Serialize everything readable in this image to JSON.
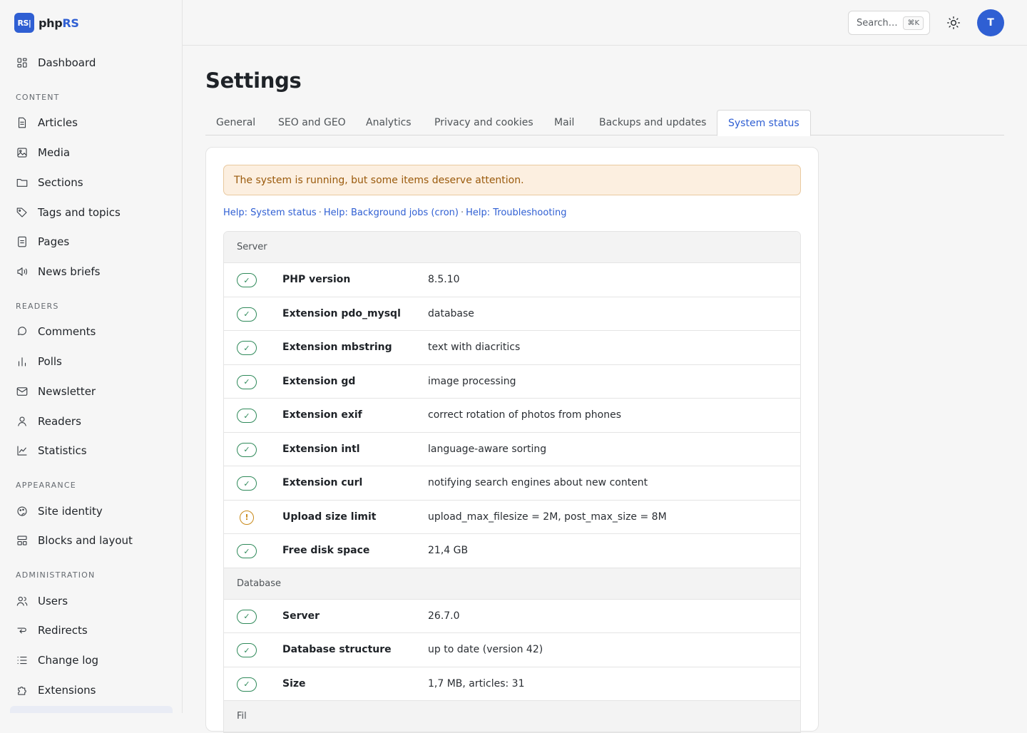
{
  "app": {
    "logo_mark": "RS|",
    "name_prefix": "php",
    "name_suffix": "RS"
  },
  "sidebar": {
    "dashboard": "Dashboard",
    "sections": [
      {
        "title": "CONTENT",
        "items": [
          "Articles",
          "Media",
          "Sections",
          "Tags and topics",
          "Pages",
          "News briefs"
        ]
      },
      {
        "title": "READERS",
        "items": [
          "Comments",
          "Polls",
          "Newsletter",
          "Readers",
          "Statistics"
        ]
      },
      {
        "title": "APPEARANCE",
        "items": [
          "Site identity",
          "Blocks and layout"
        ]
      },
      {
        "title": "ADMINISTRATION",
        "items": [
          "Users",
          "Redirects",
          "Change log",
          "Extensions"
        ]
      }
    ]
  },
  "topbar": {
    "search_placeholder": "Search…",
    "search_shortcut": "⌘K",
    "avatar_initial": "T"
  },
  "page": {
    "title": "Settings"
  },
  "tabs": [
    "General",
    "SEO and GEO",
    "Analytics",
    "Privacy and cookies",
    "Mail",
    "Backups and updates",
    "System status"
  ],
  "active_tab": "System status",
  "status": {
    "alert": "The system is running, but some items deserve attention.",
    "help_links": [
      "Help: System status",
      "Help: Background jobs (cron)",
      "Help: Troubleshooting"
    ],
    "groups": [
      {
        "title": "Server",
        "rows": [
          {
            "state": "ok",
            "label": "PHP version",
            "value": "8.5.10"
          },
          {
            "state": "ok",
            "label": "Extension pdo_mysql",
            "value": "database"
          },
          {
            "state": "ok",
            "label": "Extension mbstring",
            "value": "text with diacritics"
          },
          {
            "state": "ok",
            "label": "Extension gd",
            "value": "image processing"
          },
          {
            "state": "ok",
            "label": "Extension exif",
            "value": "correct rotation of photos from phones"
          },
          {
            "state": "ok",
            "label": "Extension intl",
            "value": "language-aware sorting"
          },
          {
            "state": "ok",
            "label": "Extension curl",
            "value": "notifying search engines about new content"
          },
          {
            "state": "warn",
            "label": "Upload size limit",
            "value": "upload_max_filesize = 2M, post_max_size = 8M"
          },
          {
            "state": "ok",
            "label": "Free disk space",
            "value": "21,4 GB"
          }
        ]
      },
      {
        "title": "Database",
        "rows": [
          {
            "state": "ok",
            "label": "Server",
            "value": "26.7.0"
          },
          {
            "state": "ok",
            "label": "Database structure",
            "value": "up to date (version 42)"
          },
          {
            "state": "ok",
            "label": "Size",
            "value": "1,7 MB, articles: 31"
          }
        ]
      },
      {
        "title": "Fil",
        "rows": []
      }
    ]
  }
}
